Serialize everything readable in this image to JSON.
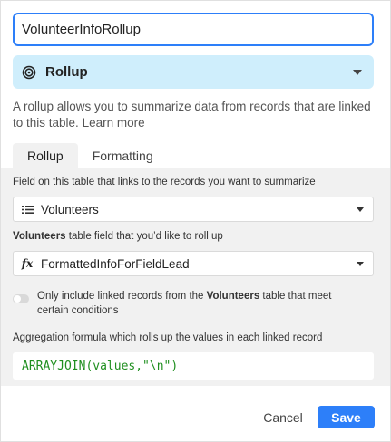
{
  "field_name": {
    "value": "VolunteerInfoRollup"
  },
  "field_type": {
    "label": "Rollup",
    "icon": "rollup-spiral-icon",
    "background": "#cfeefc"
  },
  "help_text": {
    "text": "A rollup allows you to summarize data from records that are linked to this table.",
    "link": "Learn more"
  },
  "tabs": [
    {
      "label": "Rollup",
      "active": true
    },
    {
      "label": "Formatting",
      "active": false
    }
  ],
  "link_field": {
    "label": "Field on this table that links to the records you want to summarize",
    "selected": "Volunteers",
    "icon": "list-icon"
  },
  "rollup_field": {
    "label_bold": "Volunteers",
    "label_rest": " table field that you’d like to roll up",
    "selected": "FormattedInfoForFieldLead",
    "icon": "formula-fx-icon",
    "icon_text": "fx"
  },
  "condition_toggle": {
    "text_pre": "Only include linked records from the ",
    "text_bold": "Volunteers",
    "text_post": " table that meet certain conditions",
    "on": false
  },
  "aggregation": {
    "label": "Aggregation formula which rolls up the values in each linked record",
    "formula": "ARRAYJOIN(values,\"\\n\")"
  },
  "footer": {
    "cancel_label": "Cancel",
    "save_label": "Save"
  },
  "colors": {
    "accent": "#2d7ff9",
    "formula_text": "#1f8f1f",
    "panel_gray": "#f1f1f1"
  }
}
